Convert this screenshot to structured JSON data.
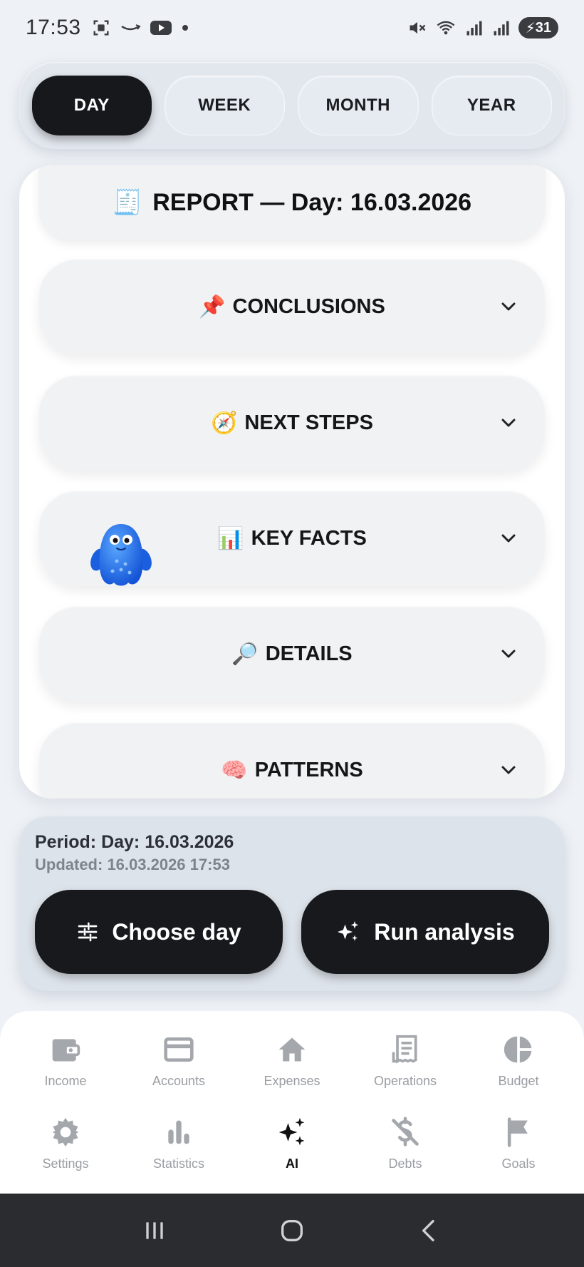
{
  "status": {
    "time": "17:53",
    "battery": "31"
  },
  "periods": {
    "day": "DAY",
    "week": "WEEK",
    "month": "MONTH",
    "year": "YEAR",
    "selected": "DAY"
  },
  "report": {
    "title_emoji": "🧾",
    "title": "REPORT — Day: 16.03.2026",
    "sections": [
      {
        "emoji": "📌",
        "label": "CONCLUSIONS"
      },
      {
        "emoji": "🧭",
        "label": "NEXT STEPS"
      },
      {
        "emoji": "📊",
        "label": "KEY FACTS"
      },
      {
        "emoji": "🔎",
        "label": "DETAILS"
      },
      {
        "emoji": "🧠",
        "label": "PATTERNS"
      }
    ]
  },
  "footer": {
    "period": "Period: Day: 16.03.2026",
    "updated": "Updated: 16.03.2026 17:53",
    "choose_day": "Choose day",
    "run_analysis": "Run analysis"
  },
  "nav": {
    "income": "Income",
    "accounts": "Accounts",
    "expenses": "Expenses",
    "operations": "Operations",
    "budget": "Budget",
    "settings": "Settings",
    "statistics": "Statistics",
    "ai": "AI",
    "debts": "Debts",
    "goals": "Goals",
    "active": "AI"
  },
  "colors": {
    "accent": "#16181b",
    "inactive_nav": "#9a9da2",
    "background": "#eef1f5"
  }
}
